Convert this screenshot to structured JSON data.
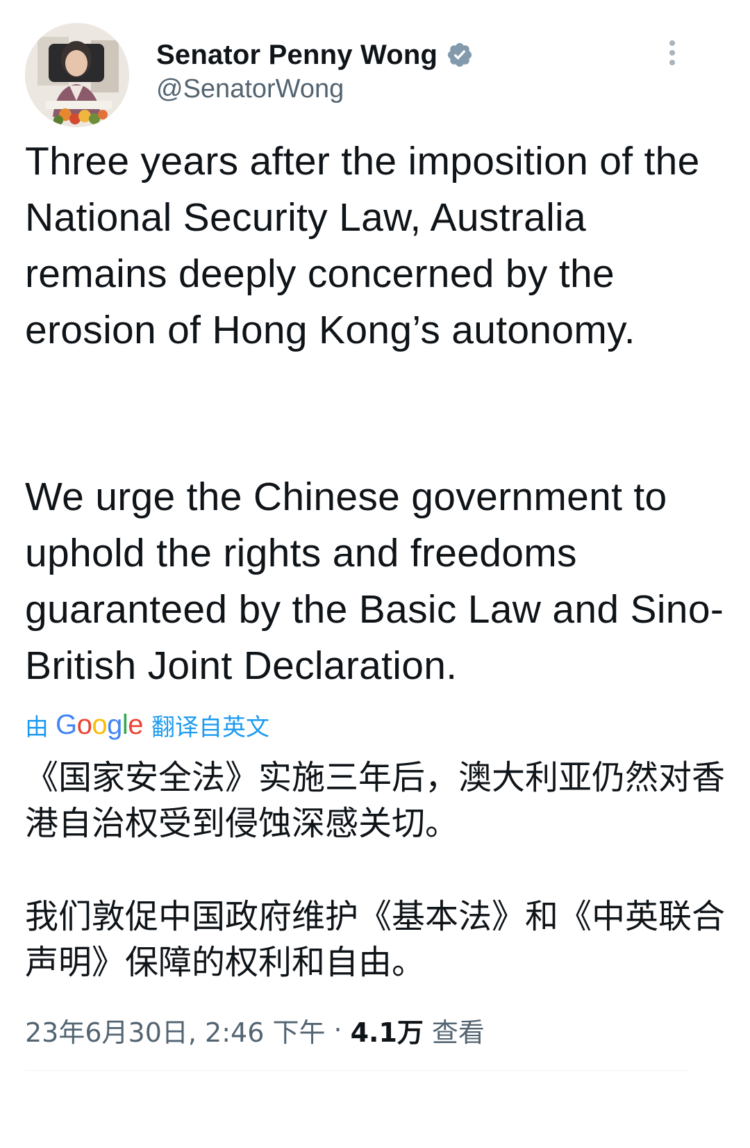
{
  "header": {
    "display_name": "Senator Penny Wong",
    "handle": "@SenatorWong",
    "verified_icon": "verified-badge-icon",
    "verified_color": "#829aab",
    "more_icon": "more-vertical-icon"
  },
  "tweet": {
    "paragraphs": [
      "Three years after the imposition of the National Security Law, Australia remains deeply concerned by the erosion of Hong Kong’s autonomy.",
      "We urge the Chinese government to uphold the rights and freedoms guaranteed by the Basic Law and Sino-British Joint Declaration."
    ]
  },
  "translation": {
    "prefix": "由",
    "provider": "Google",
    "suffix": "翻译自英文",
    "link_color": "#1d9bf0",
    "paragraphs": [
      "《国家安全法》实施三年后，澳大利亚仍然对香港自治权受到侵蚀深感关切。",
      "我们敦促中国政府维护《基本法》和《中英联合声明》保障的权利和自由。"
    ]
  },
  "meta": {
    "timestamp": "23年6月30日, 2:46 下午",
    "separator": "·",
    "views_count": "4.1万",
    "views_label": "查看"
  }
}
